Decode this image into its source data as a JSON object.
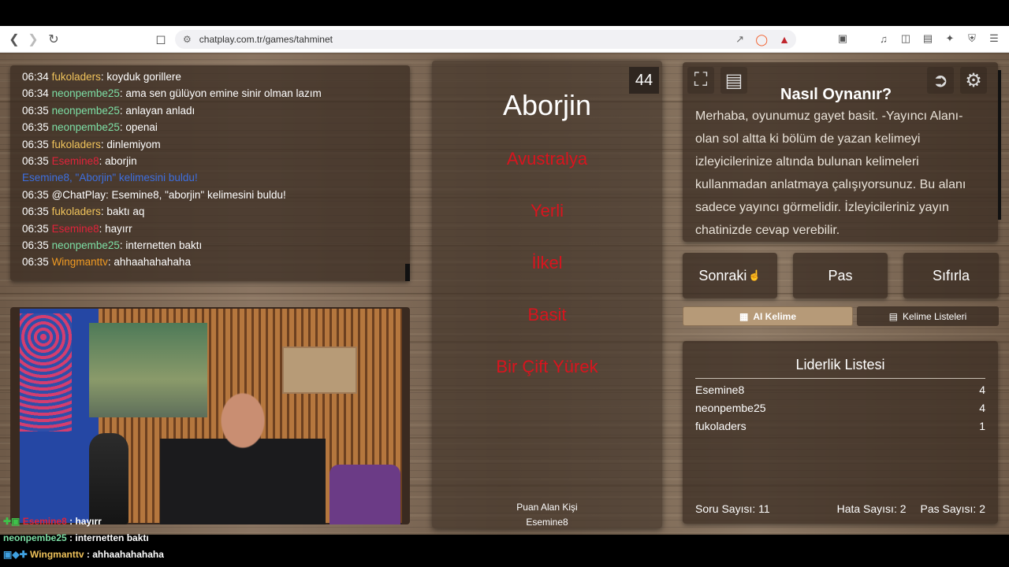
{
  "browser": {
    "url": "chatplay.com.tr/games/tahminet"
  },
  "chat": {
    "lines": [
      {
        "time": "06:34",
        "user": "fukoladers",
        "color": "#f0c35b",
        "text": ": koyduk gorillere"
      },
      {
        "time": "06:34",
        "user": "neonpembe25",
        "color": "#7de0a6",
        "text": ": ama sen gülüyon emine sinir olman lazım"
      },
      {
        "time": "06:35",
        "user": "neonpembe25",
        "color": "#7de0a6",
        "text": ": anlayan anladı"
      },
      {
        "time": "06:35",
        "user": "neonpembe25",
        "color": "#7de0a6",
        "text": ": openai"
      },
      {
        "time": "06:35",
        "user": "fukoladers",
        "color": "#f0c35b",
        "text": ": dinlemiyom"
      },
      {
        "time": "06:35",
        "user": "Esemine8",
        "color": "#e0233a",
        "text": ": aborjin"
      },
      {
        "time": "",
        "user": "",
        "color": "#3d6fe0",
        "text": "Esemine8, \"Aborjin\" kelimesini buldu!"
      },
      {
        "time": "06:35",
        "user": "@ChatPlay",
        "color": "#ffffff",
        "text": ": Esemine8, \"aborjin\" kelimesini buldu!"
      },
      {
        "time": "06:35",
        "user": "fukoladers",
        "color": "#f0c35b",
        "text": ": baktı aq"
      },
      {
        "time": "06:35",
        "user": "Esemine8",
        "color": "#e0233a",
        "text": ": hayırr"
      },
      {
        "time": "06:35",
        "user": "neonpembe25",
        "color": "#7de0a6",
        "text": ": internetten baktı"
      },
      {
        "time": "06:35",
        "user": "Wingmanttv",
        "color": "#f09a22",
        "text": ": ahhaahahahaha"
      }
    ]
  },
  "game": {
    "main_word": "Aborjin",
    "counter": "44",
    "forbidden": [
      "Avustralya",
      "Yerli",
      "İlkel",
      "Basit",
      "Bir Çift Yürek"
    ],
    "scorer_label": "Puan Alan Kişi",
    "scorer_name": "Esemine8"
  },
  "how": {
    "title": "Nasıl Oynanır?",
    "text": "Merhaba, oyunumuz gayet basit. -Yayıncı Alanı- olan sol altta ki bölüm de yazan kelimeyi izleyicilerinize altında bulunan kelimeleri kullanmadan anlatmaya çalışıyorsunuz. Bu alanı sadece yayıncı görmelidir. İzleyicileriniz yayın chatinizde cevap verebilir."
  },
  "buttons": {
    "next": "Sonraki",
    "pass": "Pas",
    "reset": "Sıfırla",
    "ai_word": "AI Kelime",
    "word_lists": "Kelime Listeleri"
  },
  "leaderboard": {
    "title": "Liderlik Listesi",
    "rows": [
      {
        "name": "Esemine8",
        "score": "4"
      },
      {
        "name": "neonpembe25",
        "score": "4"
      },
      {
        "name": "fukoladers",
        "score": "1"
      }
    ],
    "questions": "Soru Sayısı: 11",
    "errors": "Hata Sayısı: 2",
    "passes": "Pas Sayısı: 2"
  },
  "overlay": {
    "lines": [
      {
        "user": "Esemine8",
        "color": "#e0233a",
        "text": " : hayırr"
      },
      {
        "user": "neonpembe25",
        "color": "#7de0a6",
        "text": " : internetten baktı"
      },
      {
        "user": "Wingmanttv",
        "color": "#f0c35b",
        "text": " : ahhaahahahaha"
      }
    ]
  },
  "colors": {
    "forbidden": "#d9141e",
    "panel": "#372a20"
  }
}
